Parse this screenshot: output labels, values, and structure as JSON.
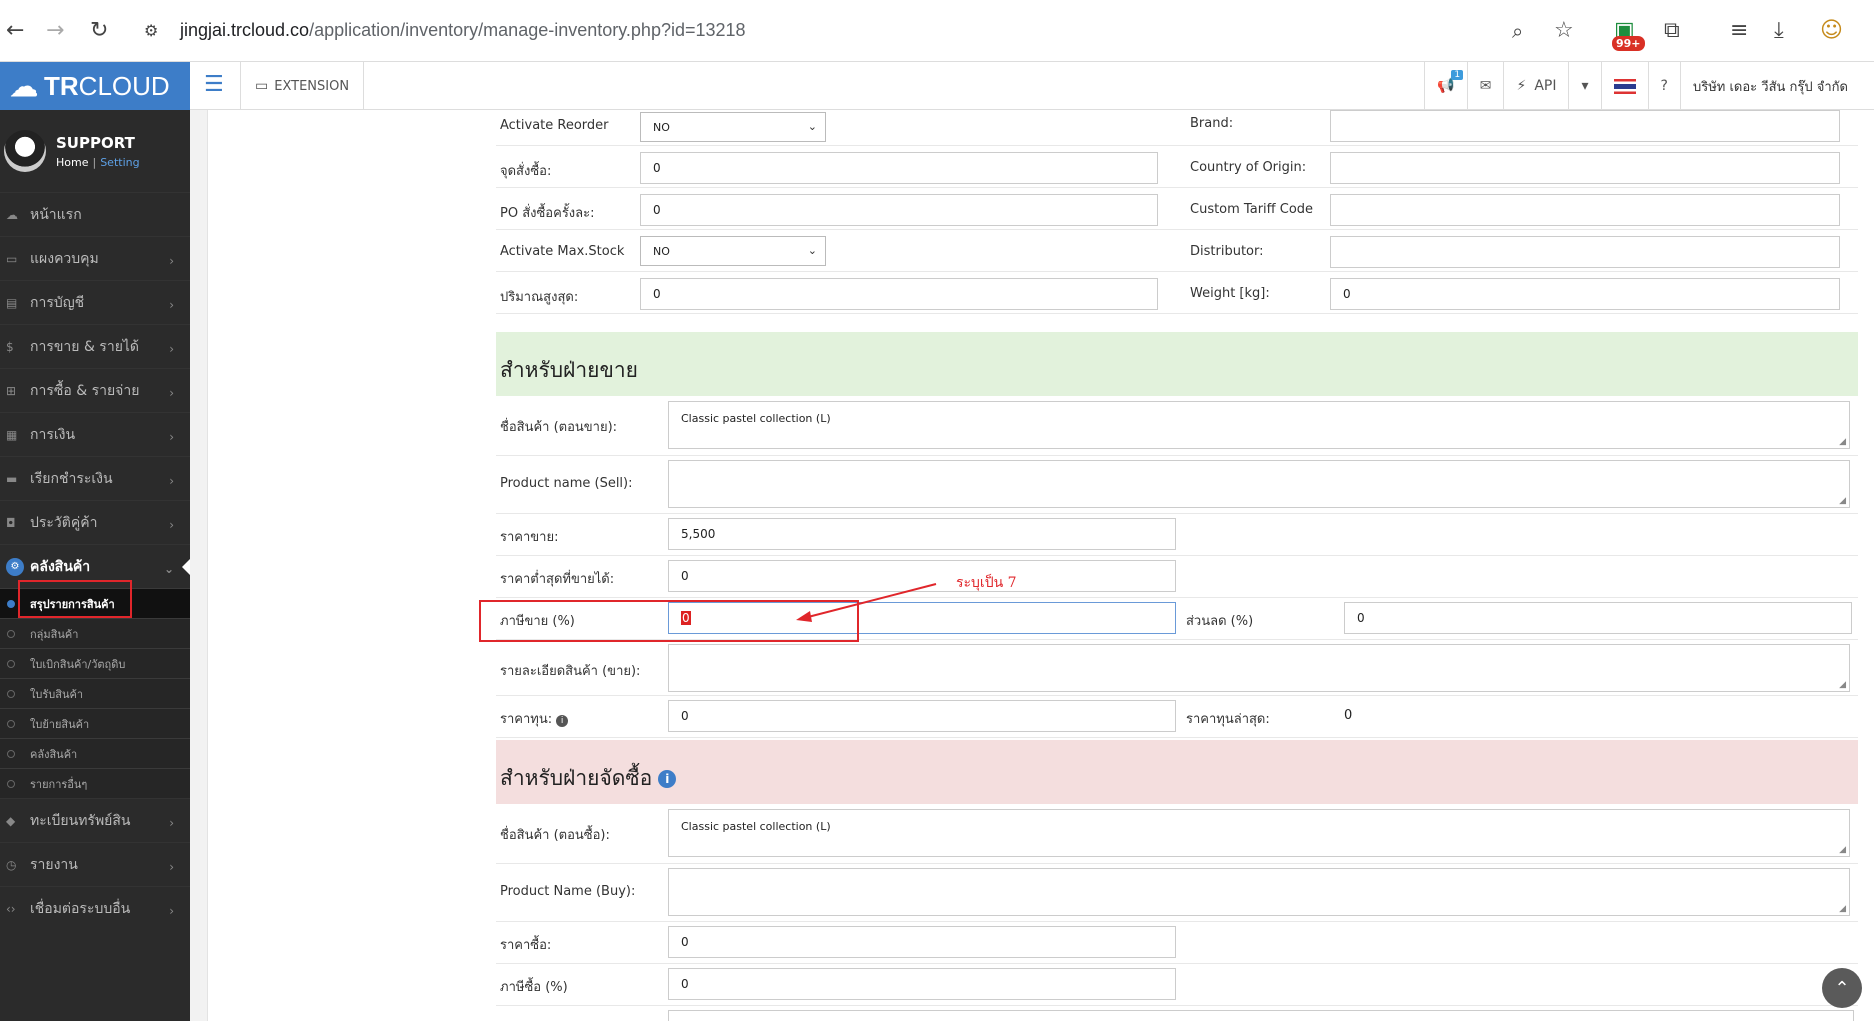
{
  "browser": {
    "url_host": "jingjai.trcloud.co",
    "url_path": "/application/inventory/manage-inventory.php?id=13218",
    "ext_badge": "99+"
  },
  "brand": {
    "name_bold": "TR",
    "name_light": "CLOUD"
  },
  "user": {
    "name": "SUPPORT",
    "home": "Home",
    "sep": "|",
    "setting": "Setting"
  },
  "nav": [
    {
      "label": "หน้าแรก",
      "icon": "cloud-icon",
      "glyph": "☁",
      "chev": false
    },
    {
      "label": "แผงควบคุม",
      "icon": "monitor-icon",
      "glyph": "▭",
      "chev": true
    },
    {
      "label": "การบัญชี",
      "icon": "book-icon",
      "glyph": "▤",
      "chev": true
    },
    {
      "label": "การขาย & รายได้",
      "icon": "dollar-icon",
      "glyph": "$",
      "chev": true
    },
    {
      "label": "การซื้อ & รายจ่าย",
      "icon": "cart-icon",
      "glyph": "⊞",
      "chev": true
    },
    {
      "label": "การเงิน",
      "icon": "calendar-icon",
      "glyph": "▦",
      "chev": true
    },
    {
      "label": "เรียกชำระเงิน",
      "icon": "card-icon",
      "glyph": "▬",
      "chev": true
    },
    {
      "label": "ประวัติคู่ค้า",
      "icon": "contact-icon",
      "glyph": "◘",
      "chev": true
    }
  ],
  "nav_active": {
    "label": "คลังสินค้า",
    "icon": "cubes-icon",
    "glyph": "⚙"
  },
  "sub_nav": [
    {
      "label": "สรุปรายการสินค้า",
      "selected": true
    },
    {
      "label": "กลุ่มสินค้า",
      "selected": false
    },
    {
      "label": "ใบเบิกสินค้า/วัตถุดิบ",
      "selected": false
    },
    {
      "label": "ใบรับสินค้า",
      "selected": false
    },
    {
      "label": "ใบย้ายสินค้า",
      "selected": false
    },
    {
      "label": "คลังสินค้า",
      "selected": false
    },
    {
      "label": "รายการอื่นๆ",
      "selected": false
    }
  ],
  "nav_after": [
    {
      "label": "ทะเบียนทรัพย์สิน",
      "icon": "diamond-icon",
      "glyph": "◆"
    },
    {
      "label": "รายงาน",
      "icon": "report-icon",
      "glyph": "◷"
    },
    {
      "label": "เชื่อมต่อระบบอื่น",
      "icon": "code-icon",
      "glyph": "‹›"
    }
  ],
  "topbar": {
    "extension": "EXTENSION",
    "notif_count": "1",
    "api": "API",
    "company": "บริษัท เดอะ วีสัน กรุ๊ป จำกัด"
  },
  "left_fields": [
    {
      "label": "Activate Reorder",
      "value": "NO",
      "type": "select"
    },
    {
      "label": "จุดสั่งซื้อ:",
      "value": "0",
      "type": "input"
    },
    {
      "label": "PO สั่งซื้อครั้งละ:",
      "value": "0",
      "type": "input"
    },
    {
      "label": "Activate Max.Stock",
      "value": "NO",
      "type": "select"
    },
    {
      "label": "ปริมาณสูงสุด:",
      "value": "0",
      "type": "input"
    }
  ],
  "right_fields": [
    {
      "label": "Brand:",
      "value": ""
    },
    {
      "label": "Country of Origin:",
      "value": ""
    },
    {
      "label": "Custom Tariff Code",
      "value": ""
    },
    {
      "label": "Distributor:",
      "value": ""
    },
    {
      "label": "Weight [kg]:",
      "value": "0"
    }
  ],
  "sales": {
    "title": "สำหรับฝ่ายขาย",
    "name_label": "ชื่อสินค้า (ตอนขาย):",
    "name_value": "Classic pastel collection (L)",
    "pname_label": "Product name (Sell):",
    "pname_value": "",
    "price_label": "ราคาขาย:",
    "price_value": "5,500",
    "min_label": "ราคาต่ำสุดที่ขายได้:",
    "min_value": "0",
    "tax_label": "ภาษีขาย (%)",
    "tax_value": "0",
    "disc_label": "ส่วนลด (%)",
    "disc_value": "0",
    "desc_label": "รายละเอียดสินค้า (ขาย):",
    "desc_value": "",
    "cost_label": "ราคาทุน:",
    "cost_value": "0",
    "lastcost_label": "ราคาทุนล่าสุด:",
    "lastcost_value": "0"
  },
  "purchase": {
    "title": "สำหรับฝ่ายจัดซื้อ",
    "name_label": "ชื่อสินค้า (ตอนซื้อ):",
    "name_value": "Classic pastel collection (L)",
    "pname_label": "Product Name (Buy):",
    "pname_value": "",
    "price_label": "ราคาซื้อ:",
    "price_value": "0",
    "tax_label": "ภาษีซื้อ (%)",
    "tax_value": "0"
  },
  "annotation": "ระบุเป็น 7",
  "colors": {
    "accent": "#3d7dc8",
    "annotation": "#e0262b",
    "sales_bg": "#e2f2dc",
    "purchase_bg": "#f4dede"
  }
}
